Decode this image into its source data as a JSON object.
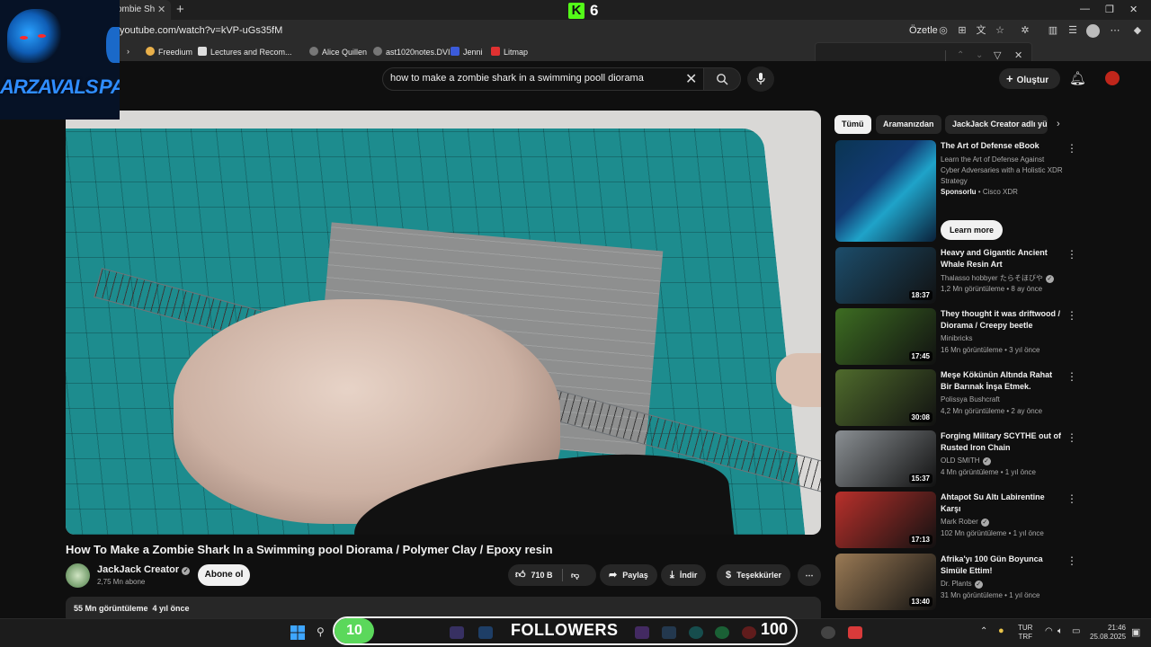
{
  "browser": {
    "tab_title": "ombie Sh",
    "url": "youtube.com/watch?v=kVP-uGs35fM",
    "translate_label": "Özetle",
    "kick_count": "6",
    "bookmarks": [
      {
        "label": "Freedium"
      },
      {
        "label": "Lectures and Recom..."
      },
      {
        "label": "Alice Quillen"
      },
      {
        "label": "ast1020notes.DVI"
      },
      {
        "label": "Jenni"
      },
      {
        "label": "Litmap"
      }
    ]
  },
  "overlay": {
    "logo_text_left": "ARZAVALS",
    "logo_text_right": "PA"
  },
  "header": {
    "search_query": "how to make a zombie shark in a swimming pooll diorama",
    "create_label": "Oluştur"
  },
  "video": {
    "title": "How To Make a Zombie Shark In a Swimming pool Diorama / Polymer Clay / Epoxy resin",
    "channel": "JackJack Creator",
    "subscribers": "2,75 Mn abone",
    "subscribe_label": "Abone ol",
    "likes": "710 B",
    "share_label": "Paylaş",
    "download_label": "İndir",
    "thanks_label": "Teşekkürler",
    "views": "55 Mn görüntüleme",
    "age": "4 yıl önce"
  },
  "sidebar": {
    "chips": [
      "Tümü",
      "Aramanızdan",
      "JackJack Creator adlı yü"
    ],
    "ad": {
      "title": "The Art of Defense eBook",
      "description": "Learn the Art of Defense Against Cyber Adversaries with a Holistic XDR Strategy",
      "sponsored_label": "Sponsorlu",
      "advertiser": "Cisco XDR",
      "cta": "Learn more"
    },
    "recommendations": [
      {
        "title": "Heavy and Gigantic Ancient Whale Resin Art",
        "channel": "Thalasso hobbyer たらそほびや",
        "verified": true,
        "meta": "1,2 Mn görüntüleme • 8 ay önce",
        "duration": "18:37",
        "thumb_color": "#1c4d6b"
      },
      {
        "title": "They thought it was driftwood / Diorama / Creepy beetle",
        "channel": "Minibricks",
        "verified": false,
        "meta": "16 Mn görüntüleme • 3 yıl önce",
        "duration": "17:45",
        "thumb_color": "#3d6d22"
      },
      {
        "title": "Meşe Kökünün Altında Rahat Bir Barınak İnşa Etmek. Hayatta ...",
        "channel": "Polissya Bushcraft",
        "verified": false,
        "meta": "4,2 Mn görüntüleme • 2 ay önce",
        "duration": "30:08",
        "thumb_color": "#4f6b2c"
      },
      {
        "title": "Forging Military SCYTHE out of Rusted Iron Chain",
        "channel": "OLD SMITH",
        "verified": true,
        "meta": "4 Mn görüntüleme • 1 yıl önce",
        "duration": "15:37",
        "thumb_color": "#8a8f93"
      },
      {
        "title": "Ahtapot Su Altı Labirentine Karşı",
        "channel": "Mark Rober",
        "verified": true,
        "meta": "102 Mn görüntüleme • 1 yıl önce",
        "duration": "17:13",
        "thumb_color": "#b9302b"
      },
      {
        "title": "Afrika'yı 100 Gün Boyunca Simüle Ettim!",
        "channel": "Dr. Plants",
        "verified": true,
        "meta": "31 Mn görüntüleme • 1 yıl önce",
        "duration": "13:40",
        "thumb_color": "#9a7a55"
      }
    ]
  },
  "taskbar": {
    "followers_count": "10",
    "followers_label": "FOLLOWERS",
    "followers_goal": "100",
    "lang_top": "TUR",
    "lang_bottom": "TRF",
    "time": "21:46",
    "date": "25.08.2025"
  }
}
